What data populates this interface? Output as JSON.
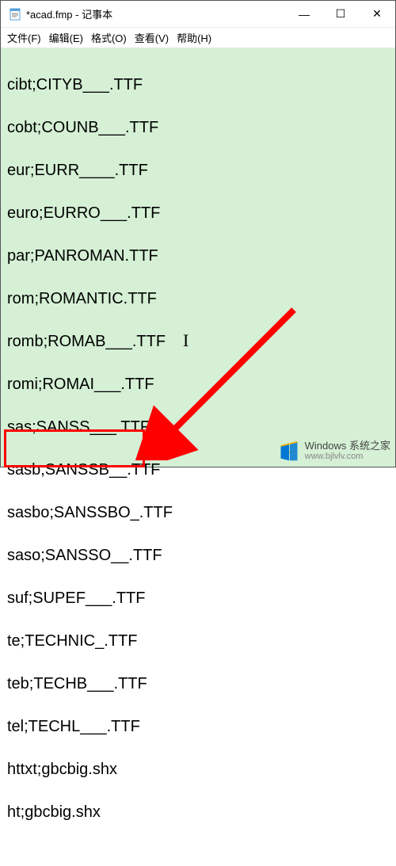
{
  "window": {
    "title": "*acad.fmp - 记事本",
    "controls": {
      "min": "—",
      "max": "☐",
      "close": "✕"
    }
  },
  "menu": {
    "file": "文件(F)",
    "edit": "编辑(E)",
    "format": "格式(O)",
    "view": "查看(V)",
    "help": "帮助(H)"
  },
  "lines": [
    "cibt;CITYB___.TTF",
    "cobt;COUNB___.TTF",
    "eur;EURR____.TTF",
    "euro;EURRO___.TTF",
    "par;PANROMAN.TTF",
    "rom;ROMANTIC.TTF",
    "romb;ROMAB___.TTF",
    "romi;ROMAI___.TTF",
    "sas;SANSS___.TTF",
    "sasb;SANSSB__.TTF",
    "sasbo;SANSSBO_.TTF",
    "saso;SANSSO__.TTF",
    "suf;SUPEF___.TTF",
    "te;TECHNIC_.TTF",
    "teb;TECHB___.TTF",
    "tel;TECHL___.TTF",
    "httxt;gbcbig.shx",
    "ht;gbcbig.shx"
  ],
  "watermark": {
    "top": "Windows 系统之家",
    "bottom": "www.bjlvlv.com"
  }
}
